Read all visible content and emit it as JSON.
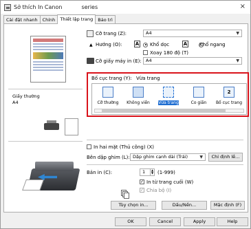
{
  "window": {
    "title_prefix": "Sở thích In Canon",
    "title_suffix": "series",
    "close_glyph": "×"
  },
  "tabs": [
    {
      "label": "Cài đặt nhanh"
    },
    {
      "label": "Chính"
    },
    {
      "label": "Thiết lập trang"
    },
    {
      "label": "Bảo trì"
    }
  ],
  "left": {
    "paper_type": "Giấy thường",
    "paper_size": "A4"
  },
  "page_size": {
    "label": "Cỡ trang (Z):",
    "value": "A4"
  },
  "orientation": {
    "label": "Hướng (O):",
    "portrait_label": "Khổ dọc",
    "landscape_label": "Khổ ngang",
    "rotate_label": "Xoay 180 độ (T)"
  },
  "printer_paper_size": {
    "label": "Cỡ giấy máy in (E):",
    "value": "A4"
  },
  "page_layout": {
    "label": "Bố cục trang (Y):",
    "current": "Vừa trang",
    "options": [
      {
        "label": "Cỡ thường"
      },
      {
        "label": "Không viền"
      },
      {
        "label": "Vừa trang"
      },
      {
        "label": "Co giãn"
      },
      {
        "label": "Bố cục trang"
      }
    ]
  },
  "duplex": {
    "label": "In hai mặt (Thủ công) (X)"
  },
  "stapling": {
    "label": "Bên dập ghim (L):",
    "value": "Dập ghim cạnh dài (Trái)",
    "button": "Chỉ định lề..."
  },
  "copies": {
    "label": "Bản in (C):",
    "value": "1",
    "range": "(1-999)",
    "last_page_first": "In từ trang cuối (W)",
    "collate": "Chia bộ (I)"
  },
  "buttons": {
    "options": "Tùy chọn in...",
    "stamp": "Dấu/Nền...",
    "defaults": "Mặc định (F)"
  },
  "footer": {
    "ok": "OK",
    "cancel": "Cancel",
    "apply": "Apply",
    "help": "Help"
  }
}
